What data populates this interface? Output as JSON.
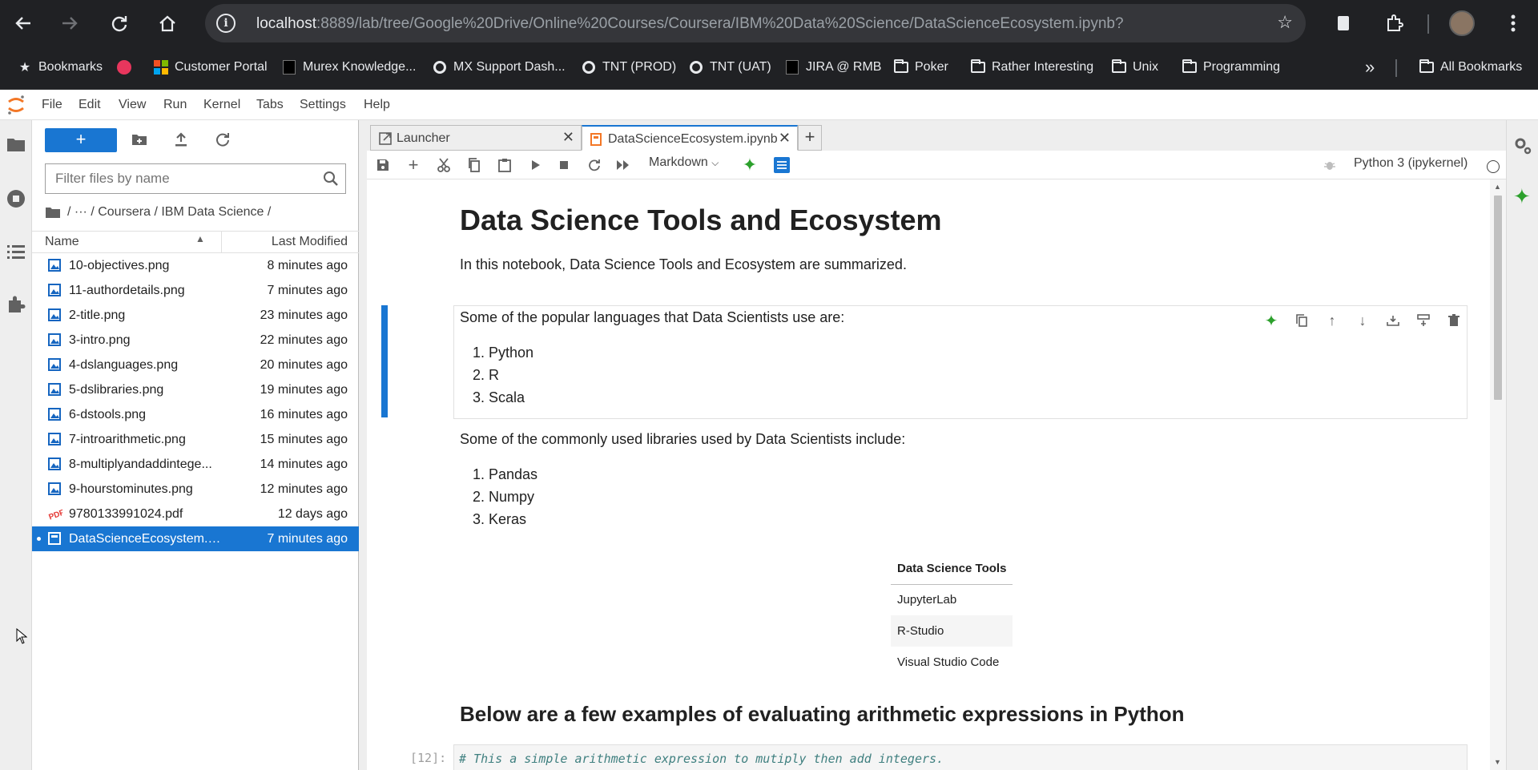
{
  "browser": {
    "url_host": "localhost",
    "url_rest": ":8889/lab/tree/Google%20Drive/Online%20Courses/Coursera/IBM%20Data%20Science/DataScienceEcosystem.ipynb?",
    "bookmarks": [
      "Bookmarks",
      "Customer Portal",
      "Murex Knowledge...",
      "MX Support Dash...",
      "TNT (PROD)",
      "TNT (UAT)",
      "JIRA @ RMB",
      "Poker",
      "Rather Interesting",
      "Unix",
      "Programming"
    ],
    "more": "»",
    "all_bookmarks": "All Bookmarks"
  },
  "menu": [
    "File",
    "Edit",
    "View",
    "Run",
    "Kernel",
    "Tabs",
    "Settings",
    "Help"
  ],
  "filebrowser": {
    "new_label": "+",
    "filter_placeholder": "Filter files by name",
    "breadcrumb": "/ ··· / Coursera / IBM Data Science /",
    "col_name": "Name",
    "col_modified": "Last Modified",
    "files": [
      {
        "name": "10-objectives.png",
        "modified": "8 minutes ago",
        "type": "image"
      },
      {
        "name": "11-authordetails.png",
        "modified": "7 minutes ago",
        "type": "image"
      },
      {
        "name": "2-title.png",
        "modified": "23 minutes ago",
        "type": "image"
      },
      {
        "name": "3-intro.png",
        "modified": "22 minutes ago",
        "type": "image"
      },
      {
        "name": "4-dslanguages.png",
        "modified": "20 minutes ago",
        "type": "image"
      },
      {
        "name": "5-dslibraries.png",
        "modified": "19 minutes ago",
        "type": "image"
      },
      {
        "name": "6-dstools.png",
        "modified": "16 minutes ago",
        "type": "image"
      },
      {
        "name": "7-introarithmetic.png",
        "modified": "15 minutes ago",
        "type": "image"
      },
      {
        "name": "8-multiplyandaddintege...",
        "modified": "14 minutes ago",
        "type": "image"
      },
      {
        "name": "9-hourstominutes.png",
        "modified": "12 minutes ago",
        "type": "image"
      },
      {
        "name": "9780133991024.pdf",
        "modified": "12 days ago",
        "type": "pdf"
      },
      {
        "name": "DataScienceEcosystem.i...",
        "modified": "7 minutes ago",
        "type": "notebook"
      }
    ]
  },
  "tabs": [
    {
      "label": "Launcher"
    },
    {
      "label": "DataScienceEcosystem.ipynb"
    }
  ],
  "toolbar": {
    "cell_type": "Markdown",
    "kernel": "Python 3 (ipykernel)"
  },
  "notebook": {
    "title": "Data Science Tools and Ecosystem",
    "intro": "In this notebook, Data Science Tools and Ecosystem are summarized.",
    "languages_intro": "Some of the popular languages that Data Scientists use are:",
    "languages": [
      "1. Python",
      "2. R",
      "3. Scala"
    ],
    "libraries_intro": "Some of the commonly used libraries used by Data Scientists include:",
    "libraries": [
      "1. Pandas",
      "2. Numpy",
      "3. Keras"
    ],
    "tools_header": "Data Science Tools",
    "tools": [
      "JupyterLab",
      "R-Studio",
      "Visual Studio Code"
    ],
    "arith_heading": "Below are a few examples of evaluating arithmetic expressions in Python",
    "code_prompt": "[12]:",
    "code_line": "# This a simple arithmetic expression to mutiply then add integers."
  },
  "colors": {
    "accent": "#1976d2",
    "chrome": "#202124",
    "ai_green": "#2ca02c"
  }
}
